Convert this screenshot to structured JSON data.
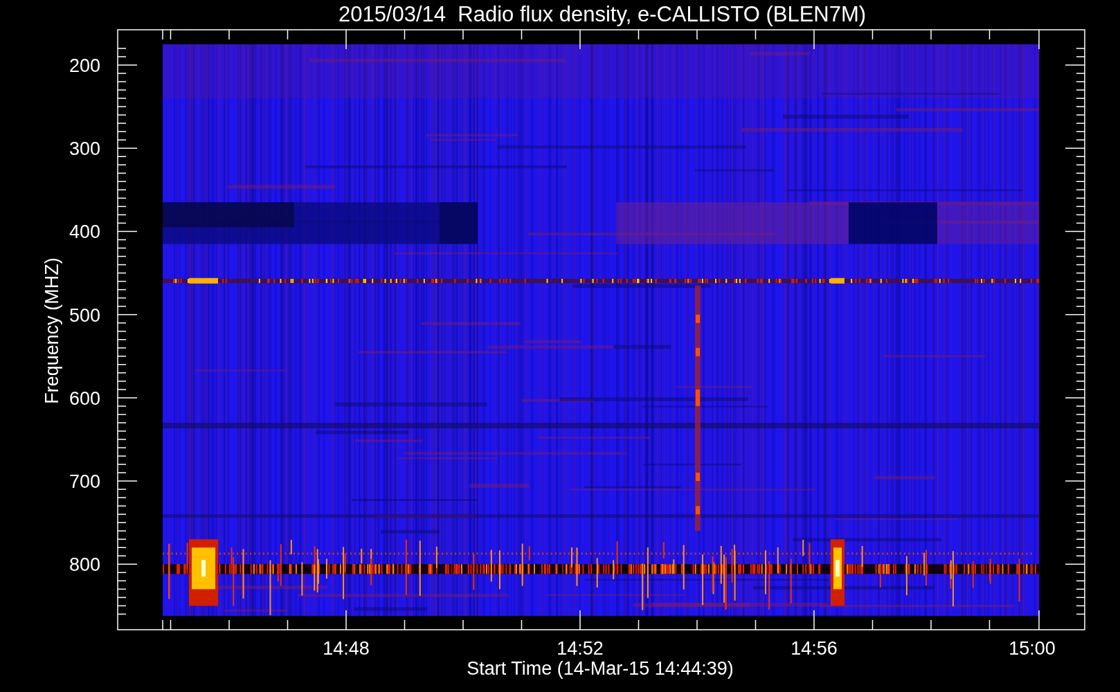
{
  "title": "2015/03/14  Radio flux density, e-CALLISTO (BLEN7M)",
  "ylabel": "Frequency (MHZ)",
  "xlabel": "Start Time (14-Mar-15 14:44:39)",
  "yticks": [
    "200",
    "300",
    "400",
    "500",
    "600",
    "700",
    "800"
  ],
  "xticks": [
    "14:48",
    "14:52",
    "14:56",
    "15:00"
  ]
}
